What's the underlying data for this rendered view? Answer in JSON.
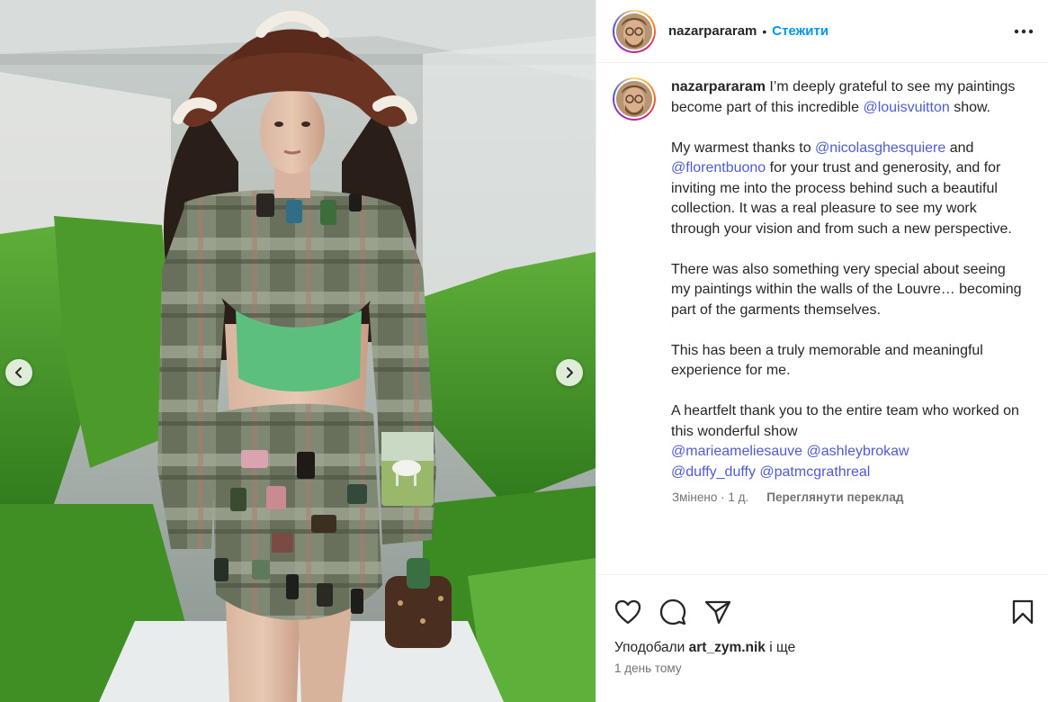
{
  "post": {
    "username": "nazarpararam",
    "follow_label": "Стежити",
    "separator": "•"
  },
  "caption": {
    "username": "nazarpararam",
    "p1_text": " I’m deeply grateful to see my paintings become part of this incredible ",
    "p1_mention": "@louisvuitton",
    "p1_end": " show.",
    "p2_start": "My warmest thanks to ",
    "p2_mention1": "@nicolasghesquiere",
    "p2_and": " and ",
    "p2_mention2": "@florentbuono",
    "p2_end": " for your trust and generosity, and for inviting me into the process behind such a beautiful collection. It was a real pleasure to see my work through your vision and from such a new perspective.",
    "p3": "There was also something very special about seeing my paintings within the walls of the Louvre… becoming part of the garments themselves.",
    "p4": "This has been a truly memorable and meaningful experience for me.",
    "p5": "A heartfelt thank you to the entire team who worked on this wonderful show",
    "tags": [
      "@marieameliesauve",
      "@ashleybrokaw",
      "@duffy_duffy",
      "@patmcgrathreal"
    ]
  },
  "meta": {
    "edited": "Змінено · 1 д.",
    "translate_label": "Переглянути переклад"
  },
  "likes": {
    "prefix": "Уподобали ",
    "user": "art_zym.nik",
    "suffix": " і ще"
  },
  "timestamp": "1 день тому",
  "icons": {
    "like": "heart-icon",
    "comment": "comment-icon",
    "share": "share-icon",
    "save": "bookmark-icon",
    "more": "more-icon",
    "prev": "chevron-left-icon",
    "next": "chevron-right-icon"
  },
  "colors": {
    "follow": "#0095f6",
    "mention": "#00376b",
    "muted": "#737373"
  }
}
